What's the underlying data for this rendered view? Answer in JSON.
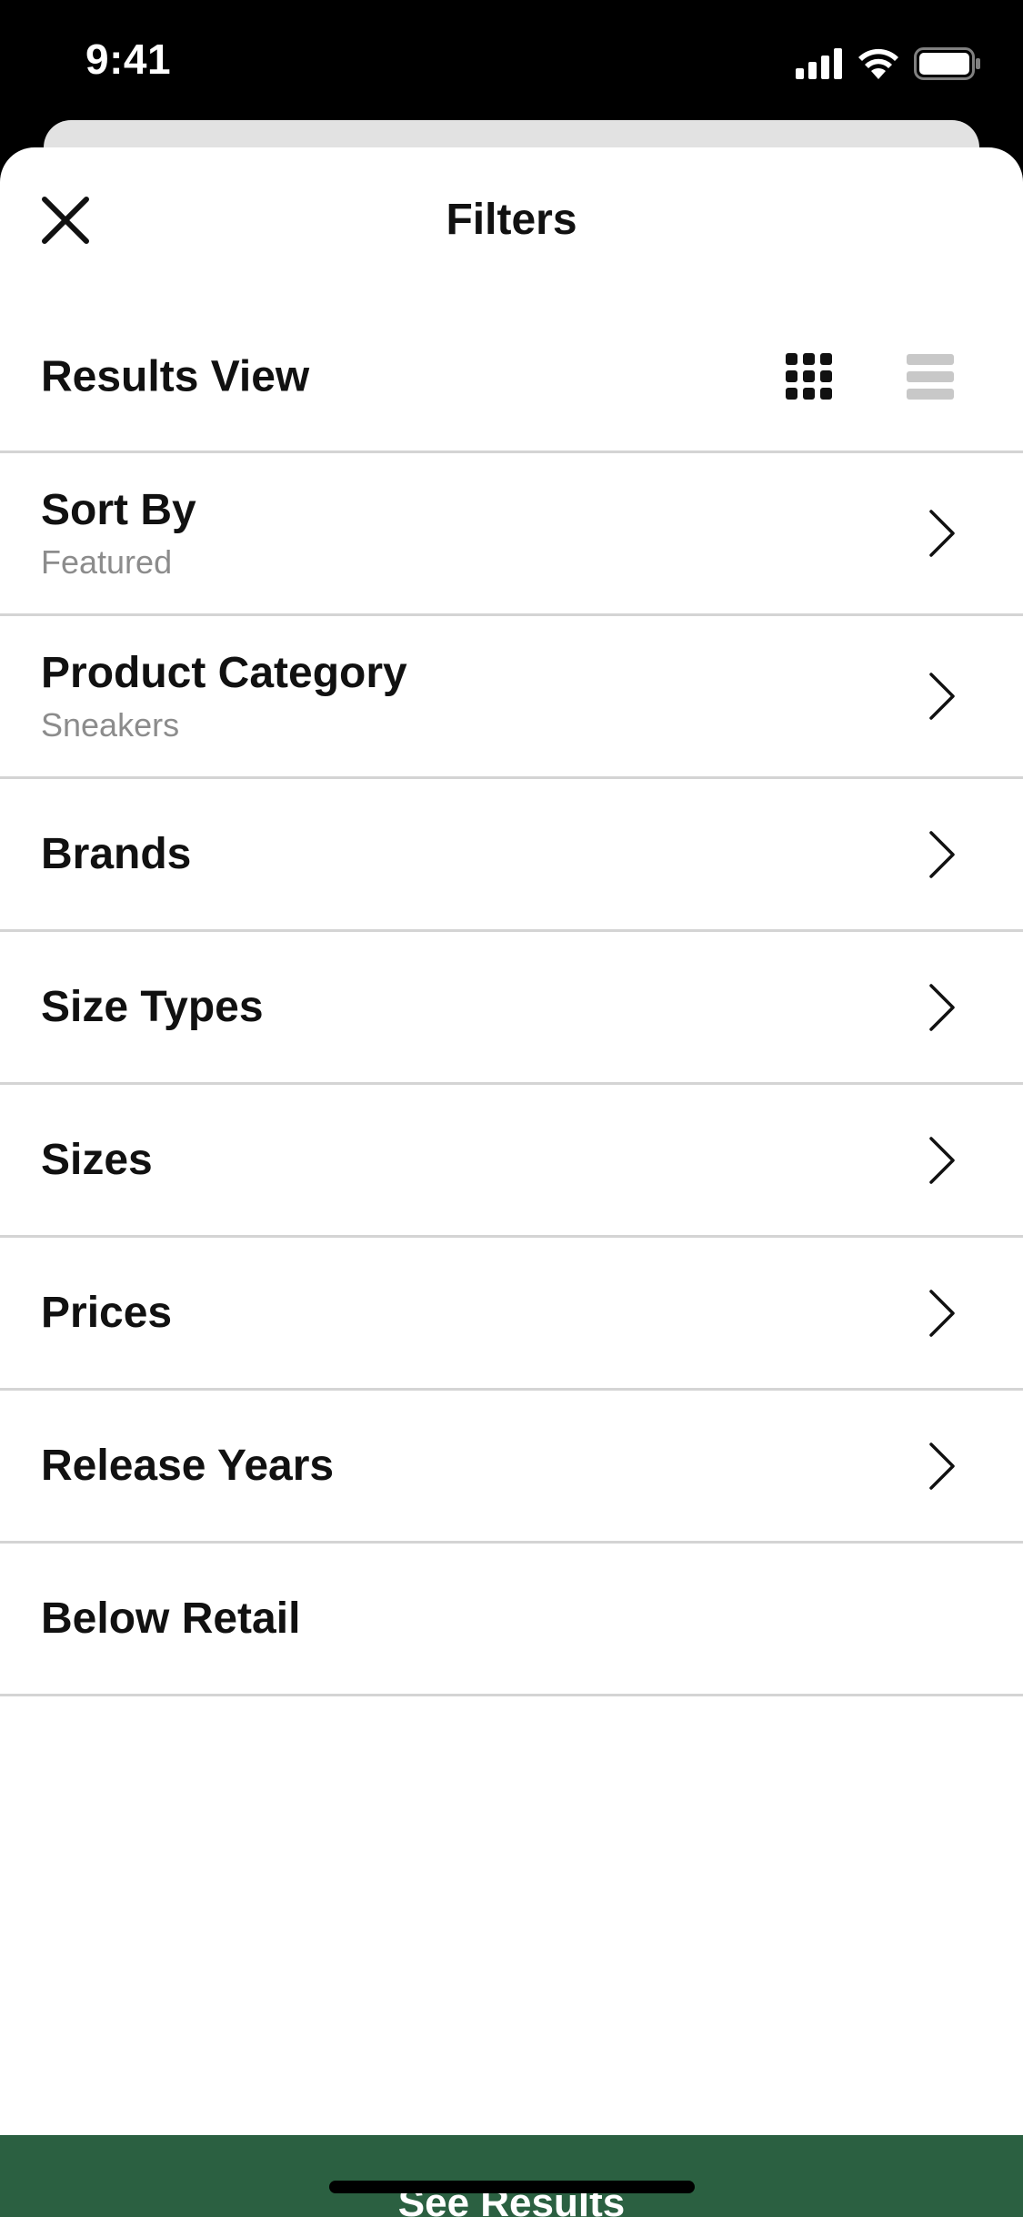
{
  "status_bar": {
    "time": "9:41",
    "icons": [
      "cellular-signal-icon",
      "wifi-icon",
      "battery-icon"
    ]
  },
  "header": {
    "title": "Filters",
    "close_icon": "close-icon"
  },
  "results_view": {
    "label": "Results View",
    "options": [
      {
        "icon": "grid-view-icon",
        "selected": true
      },
      {
        "icon": "list-view-icon",
        "selected": false
      }
    ]
  },
  "filters": [
    {
      "label": "Sort By",
      "value": "Featured",
      "has_chevron": true
    },
    {
      "label": "Product Category",
      "value": "Sneakers",
      "has_chevron": true
    },
    {
      "label": "Brands",
      "has_chevron": true
    },
    {
      "label": "Size Types",
      "has_chevron": true
    },
    {
      "label": "Sizes",
      "has_chevron": true
    },
    {
      "label": "Prices",
      "has_chevron": true
    },
    {
      "label": "Release Years",
      "has_chevron": true
    },
    {
      "label": "Below Retail",
      "has_chevron": false
    }
  ],
  "footer": {
    "button_label": "See Results"
  },
  "colors": {
    "accent": "#2b6041",
    "text": "#111111",
    "subtext": "#8c8c8c",
    "divider": "#d4d4d4",
    "inactive_icon": "#c8c8c8"
  }
}
